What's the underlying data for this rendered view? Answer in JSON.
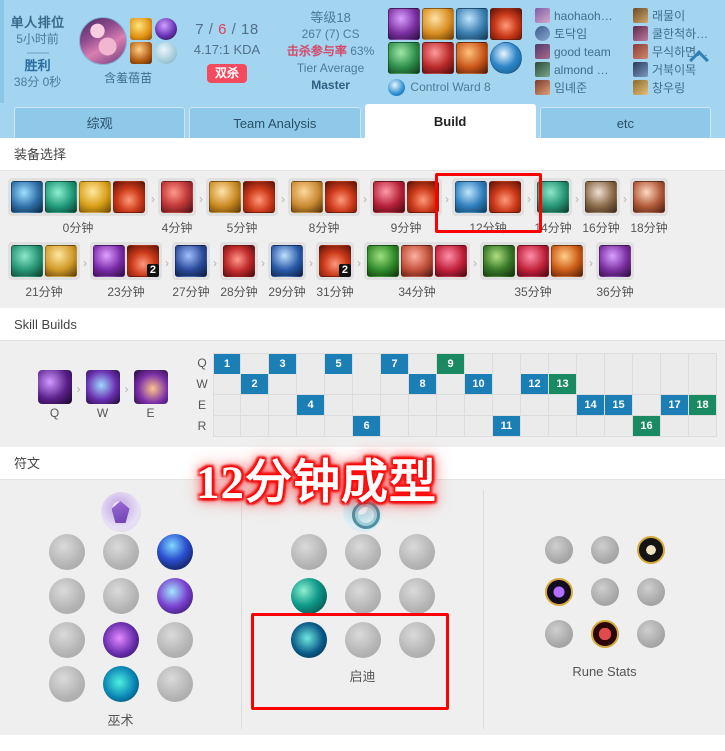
{
  "header": {
    "queue": "单人排位",
    "time_ago": "5小时前",
    "result": "胜利",
    "duration": "38分 0秒",
    "champion_name": "含羞蓓苗",
    "kda_kills": "7",
    "kda_sep1": "/",
    "kda_deaths": "6",
    "kda_sep2": "/",
    "kda_assists": "18",
    "kda_ratio": "4.17:1 KDA",
    "multikill_badge": "双杀",
    "level": "等级18",
    "cs": "267 (7) CS",
    "kp_label": "击杀参与率",
    "kp_value": "63%",
    "tier_average_label": "Tier Average",
    "tier_average_value": "Master",
    "control_ward": "Control Ward 8",
    "collapse_icon": "chevron-up-icon",
    "ward_icon": "ward-icon",
    "players_left": [
      "haohaoh…",
      "토닥임",
      "good team",
      "almond …",
      "임녜준"
    ],
    "players_right": [
      "래물이",
      "쿨한척하…",
      "무식하면…",
      "거북이목",
      "창우링"
    ]
  },
  "tabs": [
    {
      "label": "综观",
      "active": false
    },
    {
      "label": "Team Analysis",
      "active": false
    },
    {
      "label": "Build",
      "active": true
    },
    {
      "label": "etc",
      "active": false
    }
  ],
  "sections": {
    "items_title": "装备选择",
    "skills_title": "Skill Builds",
    "runes_title": "符文"
  },
  "item_timeline": {
    "row1": [
      {
        "time": "0分钟",
        "items": [
          {
            "art": "it-boots",
            "stack": ""
          },
          {
            "art": "it-crystal",
            "stack": ""
          },
          {
            "art": "it-orb",
            "stack": ""
          },
          {
            "art": "it-red",
            "stack": ""
          }
        ]
      },
      {
        "time": "4分钟",
        "items": [
          {
            "art": "it-rboot",
            "stack": ""
          }
        ]
      },
      {
        "time": "5分钟",
        "items": [
          {
            "art": "it-gold",
            "stack": ""
          },
          {
            "art": "it-red",
            "stack": ""
          }
        ]
      },
      {
        "time": "8分钟",
        "items": [
          {
            "art": "it-wand",
            "stack": ""
          },
          {
            "art": "it-red",
            "stack": ""
          }
        ]
      },
      {
        "time": "9分钟",
        "items": [
          {
            "art": "it-ruby",
            "stack": ""
          },
          {
            "art": "it-red",
            "stack": ""
          }
        ]
      },
      {
        "time": "12分钟",
        "items": [
          {
            "art": "it-blue",
            "stack": ""
          },
          {
            "art": "it-red",
            "stack": ""
          }
        ],
        "highlight": true
      },
      {
        "time": "14分钟",
        "items": [
          {
            "art": "it-tear",
            "stack": ""
          }
        ]
      },
      {
        "time": "16分钟",
        "items": [
          {
            "art": "it-pot",
            "stack": ""
          }
        ]
      },
      {
        "time": "18分钟",
        "items": [
          {
            "art": "it-book",
            "stack": ""
          }
        ]
      }
    ],
    "row2": [
      {
        "time": "21分钟",
        "items": [
          {
            "art": "it-tear",
            "stack": ""
          },
          {
            "art": "it-rod",
            "stack": ""
          }
        ]
      },
      {
        "time": "23分钟",
        "items": [
          {
            "art": "it-mage",
            "stack": ""
          },
          {
            "art": "it-red",
            "stack": "2"
          }
        ]
      },
      {
        "time": "27分钟",
        "items": [
          {
            "art": "it-tome",
            "stack": ""
          }
        ]
      },
      {
        "time": "28分钟",
        "items": [
          {
            "art": "it-rx",
            "stack": ""
          }
        ]
      },
      {
        "time": "29分钟",
        "items": [
          {
            "art": "it-gstaff",
            "stack": ""
          }
        ]
      },
      {
        "time": "31分钟",
        "items": [
          {
            "art": "it-red",
            "stack": "2"
          }
        ]
      },
      {
        "time": "34分钟",
        "items": [
          {
            "art": "it-green",
            "stack": ""
          },
          {
            "art": "it-rcrys",
            "stack": ""
          },
          {
            "art": "it-gem",
            "stack": ""
          }
        ]
      },
      {
        "time": "35分钟",
        "items": [
          {
            "art": "it-grass",
            "stack": ""
          },
          {
            "art": "it-gem",
            "stack": ""
          },
          {
            "art": "it-fire",
            "stack": ""
          }
        ]
      },
      {
        "time": "36分钟",
        "items": [
          {
            "art": "it-deathcap",
            "stack": ""
          }
        ]
      }
    ]
  },
  "skill_order": {
    "icons": [
      {
        "key": "Q",
        "art": "sk-q"
      },
      {
        "key": "W",
        "art": "sk-w"
      },
      {
        "key": "E",
        "art": "sk-e"
      }
    ],
    "rows": [
      {
        "key": "Q",
        "levels": [
          1,
          3,
          5,
          7,
          9
        ]
      },
      {
        "key": "W",
        "levels": [
          2,
          8,
          10,
          12,
          13
        ]
      },
      {
        "key": "E",
        "levels": [
          4,
          14,
          15,
          17,
          18
        ]
      },
      {
        "key": "R",
        "levels": [
          6,
          11,
          16
        ],
        "ultimate": true
      }
    ],
    "ultimate_levels": [
      6,
      11,
      16
    ],
    "green_levels": [
      9,
      13,
      18,
      16
    ],
    "total_levels": 18
  },
  "runes": {
    "primary": {
      "name": "巫术",
      "keystone": "sorcery-keystone",
      "rows": [
        {
          "slots": [
            "dim",
            "dim",
            "sel-blue"
          ]
        },
        {
          "slots": [
            "dim",
            "dim",
            "sel-cyanpurp"
          ]
        },
        {
          "slots": [
            "dim",
            "sel-purp",
            "dim"
          ]
        },
        {
          "slots": [
            "dim",
            "sel-teal",
            "dim"
          ]
        }
      ]
    },
    "secondary": {
      "name": "启迪",
      "keystone": "inspiration-keystone",
      "rows": [
        {
          "slots": [
            "dim",
            "dim",
            "dim"
          ]
        },
        {
          "slots": [
            "sel-gems",
            "dim",
            "dim"
          ],
          "highlight": true
        },
        {
          "slots": [
            "sel-eye",
            "dim",
            "dim"
          ],
          "highlight": true
        }
      ]
    },
    "stats": {
      "name": "Rune Stats",
      "rows": [
        {
          "slots": [
            "off",
            "off",
            "hour"
          ]
        },
        {
          "slots": [
            "purple",
            "off",
            "off"
          ]
        },
        {
          "slots": [
            "off",
            "redshield",
            "off"
          ]
        }
      ]
    }
  },
  "overlay": {
    "text": "12分钟成型"
  },
  "colors": {
    "header_bg": "#a3d4f0",
    "accent_blue": "#1b7fb5",
    "ultimate_green": "#1a8a62",
    "highlight_red": "#ff0000",
    "death_red": "#e0405a"
  }
}
